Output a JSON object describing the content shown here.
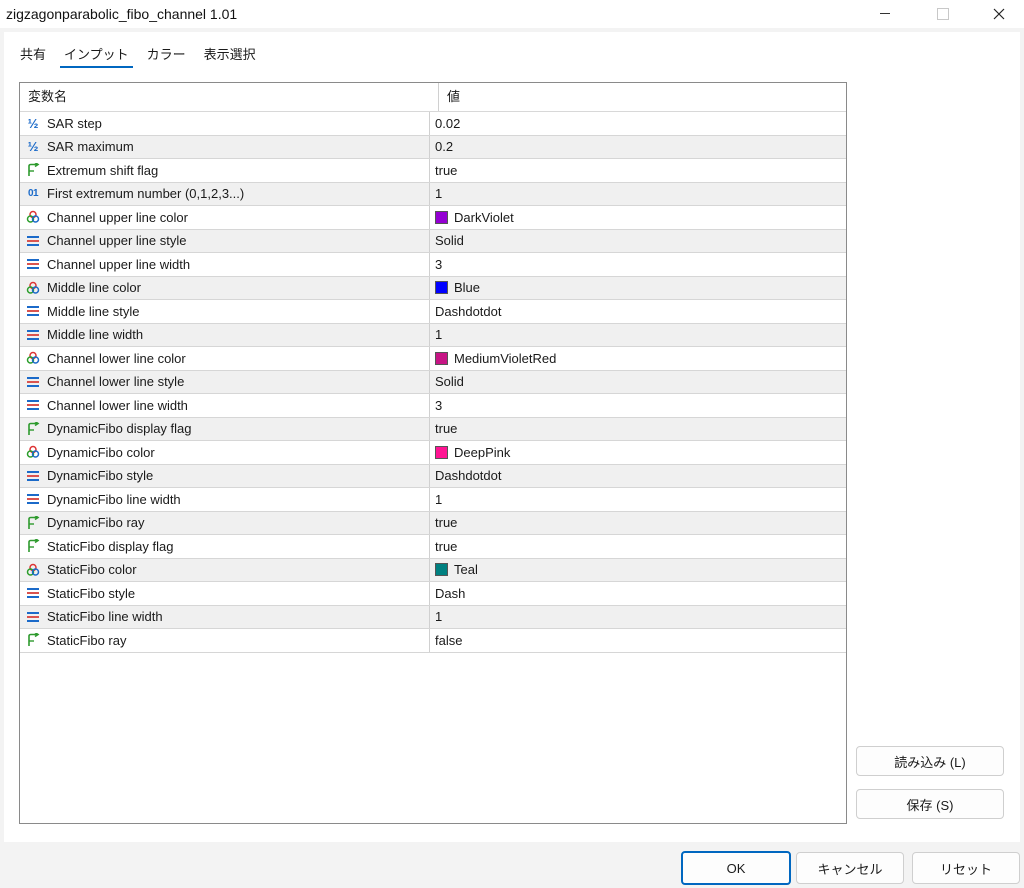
{
  "window": {
    "title": "zigzagonparabolic_fibo_channel 1.01"
  },
  "tabs": [
    {
      "label": "共有"
    },
    {
      "label": "インプット"
    },
    {
      "label": "カラー"
    },
    {
      "label": "表示選択"
    }
  ],
  "grid": {
    "col_name": "変数名",
    "col_value": "値",
    "rows": [
      {
        "icon": "fraction-icon",
        "name": "SAR step",
        "value": "0.02"
      },
      {
        "icon": "fraction-icon",
        "name": "SAR maximum",
        "value": "0.2"
      },
      {
        "icon": "flag-arrow-icon",
        "name": "Extremum shift flag",
        "value": "true"
      },
      {
        "icon": "integer-icon",
        "name": "First extremum number (0,1,2,3...)",
        "value": "1"
      },
      {
        "icon": "color-palette-icon",
        "name": "Channel upper line color",
        "value": "DarkViolet",
        "color": "#9400d3"
      },
      {
        "icon": "line-style-icon",
        "name": "Channel upper line style",
        "value": "Solid"
      },
      {
        "icon": "line-style-icon",
        "name": "Channel upper line width",
        "value": "3"
      },
      {
        "icon": "color-palette-icon",
        "name": "Middle line color",
        "value": "Blue",
        "color": "#0000ff"
      },
      {
        "icon": "line-style-icon",
        "name": "Middle line style",
        "value": "Dashdotdot"
      },
      {
        "icon": "line-style-icon",
        "name": "Middle line width",
        "value": "1"
      },
      {
        "icon": "color-palette-icon",
        "name": "Channel lower line color",
        "value": "MediumVioletRed",
        "color": "#c71585"
      },
      {
        "icon": "line-style-icon",
        "name": "Channel lower line style",
        "value": "Solid"
      },
      {
        "icon": "line-style-icon",
        "name": "Channel lower line width",
        "value": "3"
      },
      {
        "icon": "flag-arrow-icon",
        "name": "DynamicFibo display flag",
        "value": "true"
      },
      {
        "icon": "color-palette-icon",
        "name": "DynamicFibo color",
        "value": "DeepPink",
        "color": "#ff1493"
      },
      {
        "icon": "line-style-icon",
        "name": "DynamicFibo style",
        "value": "Dashdotdot"
      },
      {
        "icon": "line-style-icon",
        "name": "DynamicFibo line width",
        "value": "1"
      },
      {
        "icon": "flag-arrow-icon",
        "name": "DynamicFibo ray",
        "value": "true"
      },
      {
        "icon": "flag-arrow-icon",
        "name": "StaticFibo display flag",
        "value": "true"
      },
      {
        "icon": "color-palette-icon",
        "name": "StaticFibo color",
        "value": "Teal",
        "color": "#008080"
      },
      {
        "icon": "line-style-icon",
        "name": "StaticFibo style",
        "value": "Dash"
      },
      {
        "icon": "line-style-icon",
        "name": "StaticFibo line width",
        "value": "1"
      },
      {
        "icon": "flag-arrow-icon",
        "name": "StaticFibo ray",
        "value": "false"
      }
    ]
  },
  "side_buttons": {
    "load": "読み込み (L)",
    "save": "保存 (S)"
  },
  "footer": {
    "ok": "OK",
    "cancel": "キャンセル",
    "reset": "リセット"
  },
  "colors": {
    "accent": "#0067c0",
    "alt_row": "#f0f0f0"
  }
}
